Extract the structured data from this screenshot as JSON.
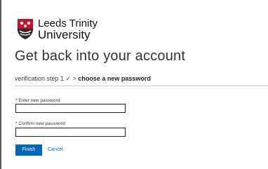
{
  "brand": {
    "name_line1": "Leeds Trinity",
    "name_line2": "University",
    "logo_icon": "crest-shield-icon",
    "shield_color": "#c8102e"
  },
  "page": {
    "title": "Get back into your account"
  },
  "steps": {
    "done_label": "verification step 1",
    "check": "✓",
    "separator": ">",
    "current_label": "choose a new password"
  },
  "form": {
    "required_marker": "*",
    "new_password": {
      "label": "Enter new password:",
      "value": ""
    },
    "confirm_password": {
      "label": "Confirm new password:",
      "value": ""
    },
    "finish_label": "Finish",
    "cancel_label": "Cancel"
  },
  "colors": {
    "accent": "#0067b8"
  }
}
